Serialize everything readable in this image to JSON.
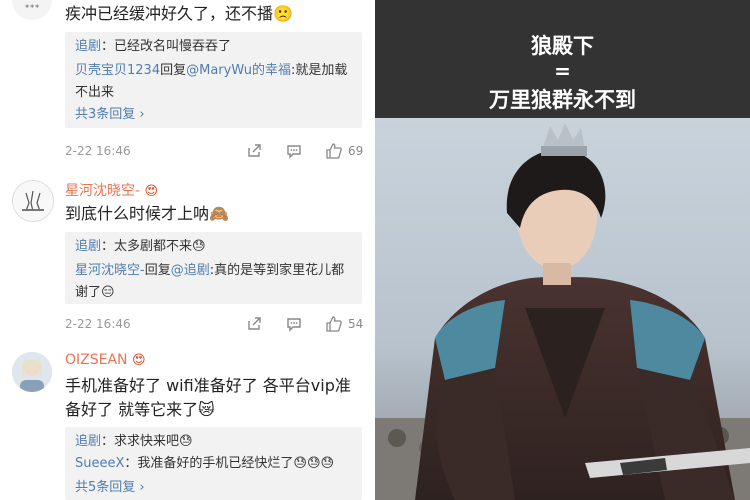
{
  "comments": [
    {
      "user": "",
      "text": "疾冲已经缓冲好久了，还不播🙁",
      "replies": [
        {
          "name": "追剧",
          "body": "：已经改名叫慢吞吞了"
        },
        {
          "name": "贝壳宝贝1234",
          "body": "回复",
          "mention": "@MaryWu的幸福",
          "tail": ":就是加载不出来"
        }
      ],
      "more": "共3条回复 ›",
      "time": "2-22 16:46",
      "likes": "69"
    },
    {
      "user": "星河沈晓空-",
      "user_badge": "😍",
      "text": "到底什么时候才上呐🙈",
      "replies": [
        {
          "name": "追剧",
          "body": "：太多剧都不来😓"
        },
        {
          "name": "星河沈晓空-",
          "body": "回复",
          "mention": "@追剧",
          "tail": ":真的是等到家里花儿都谢了😑"
        }
      ],
      "time": "2-22 16:46",
      "likes": "54"
    },
    {
      "user": "OIZSEAN",
      "user_badge": "😍",
      "text": "手机准备好了 wifi准备好了 各平台vip准备好了 就等它来了😿",
      "replies": [
        {
          "name": "追剧",
          "body": "：求求快来吧😓"
        },
        {
          "name": "SueeeX",
          "body": "：我准备好的手机已经快烂了😓😓😓"
        }
      ],
      "more": "共5条回复 ›"
    }
  ],
  "panel": {
    "line1": "狼殿下",
    "line2": "=",
    "line3": "万里狼群永不到"
  },
  "colors": {
    "username": "#eb7350",
    "link": "#507daf",
    "reply_bg": "#f2f2f2",
    "panel_bg": "#333334"
  }
}
